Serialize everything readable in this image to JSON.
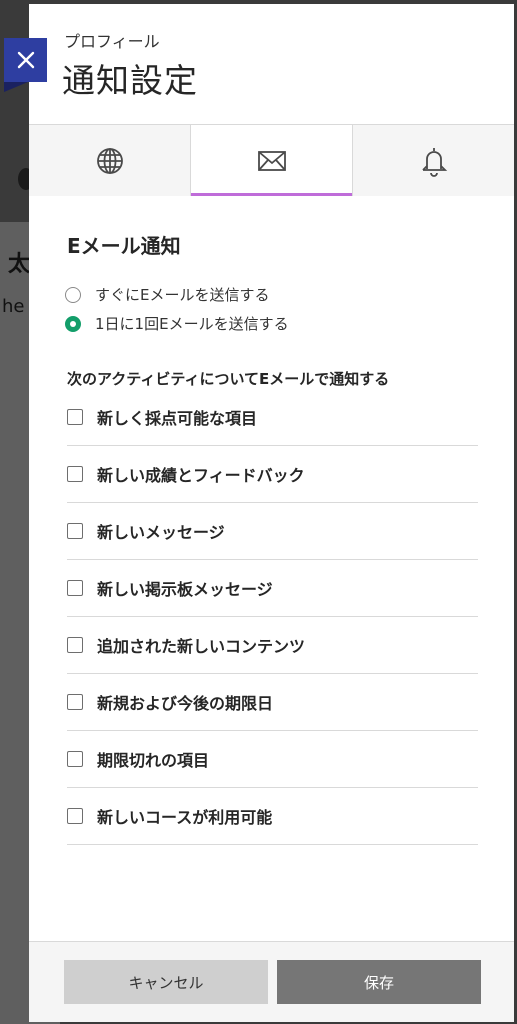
{
  "background": {
    "heading_fragment": "太",
    "text_fragment": "he"
  },
  "header": {
    "profile_label": "プロフィール",
    "title": "通知設定"
  },
  "tabs": [
    {
      "icon": "globe-icon",
      "active": false
    },
    {
      "icon": "envelope-icon",
      "active": true
    },
    {
      "icon": "bell-icon",
      "active": false
    }
  ],
  "email_section": {
    "title": "Eメール通知",
    "frequency_options": [
      {
        "label": "すぐにEメールを送信する",
        "checked": false
      },
      {
        "label": "1日に1回Eメールを送信する",
        "checked": true
      }
    ],
    "activity_heading": "次のアクティビティについてEメールで通知する",
    "activities": [
      {
        "label": "新しく採点可能な項目",
        "checked": false
      },
      {
        "label": "新しい成績とフィードバック",
        "checked": false
      },
      {
        "label": "新しいメッセージ",
        "checked": false
      },
      {
        "label": "新しい掲示板メッセージ",
        "checked": false
      },
      {
        "label": "追加された新しいコンテンツ",
        "checked": false
      },
      {
        "label": "新規および今後の期限日",
        "checked": false
      },
      {
        "label": "期限切れの項目",
        "checked": false
      },
      {
        "label": "新しいコースが利用可能",
        "checked": false
      }
    ]
  },
  "footer": {
    "cancel_label": "キャンセル",
    "save_label": "保存"
  },
  "colors": {
    "accent_tab": "#bf6cd9",
    "radio_selected": "#139e6a",
    "close_button": "#2e3ea1",
    "save_button": "#767676",
    "cancel_button": "#cfcfcf"
  }
}
